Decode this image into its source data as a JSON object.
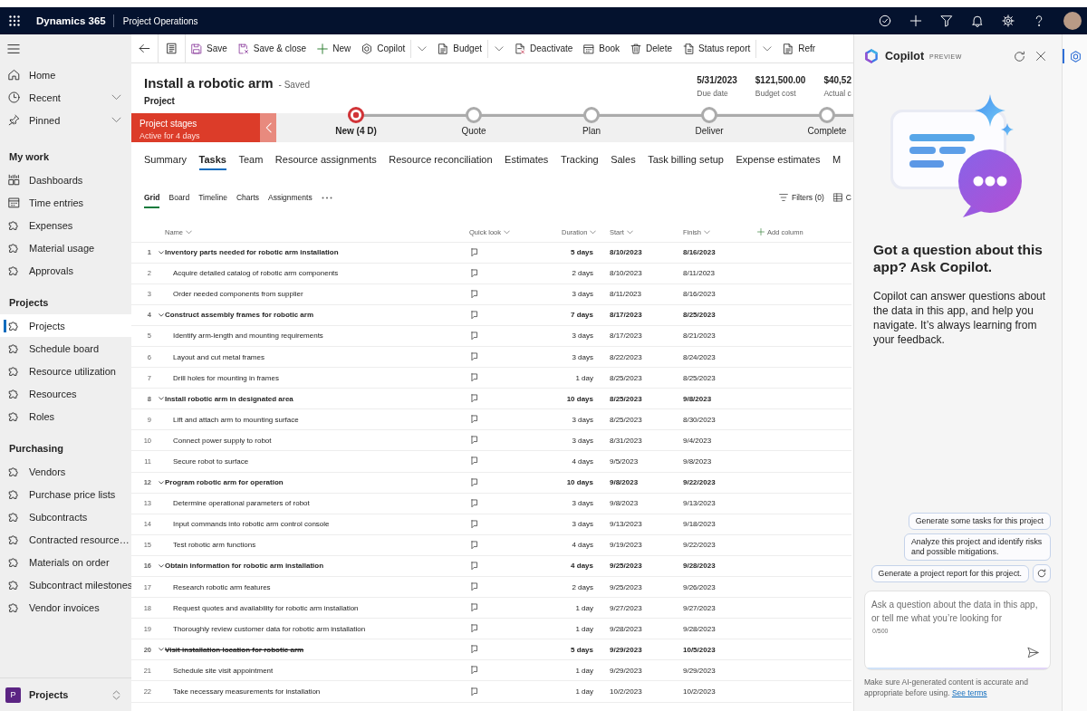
{
  "top_bar": {
    "app_name": "Dynamics 365",
    "area_name": "Project Operations"
  },
  "sidebar": {
    "top_items": [
      {
        "label": "Home",
        "selected": false
      },
      {
        "label": "Recent",
        "selected": false,
        "expanded": false
      },
      {
        "label": "Pinned",
        "selected": false,
        "expanded": false
      }
    ],
    "sections": [
      {
        "title": "My work",
        "items": [
          {
            "label": "Dashboards",
            "selected": false
          },
          {
            "label": "Time entries",
            "selected": false
          },
          {
            "label": "Expenses",
            "selected": false
          },
          {
            "label": "Material usage",
            "selected": false
          },
          {
            "label": "Approvals",
            "selected": false
          }
        ]
      },
      {
        "title": "Projects",
        "items": [
          {
            "label": "Projects",
            "selected": true
          },
          {
            "label": "Schedule board",
            "selected": false
          },
          {
            "label": "Resource utilization",
            "selected": false
          },
          {
            "label": "Resources",
            "selected": false
          },
          {
            "label": "Roles",
            "selected": false
          }
        ]
      },
      {
        "title": "Purchasing",
        "items": [
          {
            "label": "Vendors",
            "selected": false
          },
          {
            "label": "Purchase price lists",
            "selected": false
          },
          {
            "label": "Subcontracts",
            "selected": false
          },
          {
            "label": "Contracted resource…",
            "selected": false
          },
          {
            "label": "Materials on order",
            "selected": false
          },
          {
            "label": "Subcontract milestones",
            "selected": false
          },
          {
            "label": "Vendor invoices",
            "selected": false
          }
        ]
      }
    ],
    "area_switcher": {
      "badge": "P",
      "label": "Projects"
    }
  },
  "toolbar": {
    "items": [
      {
        "kind": "icon"
      },
      {
        "kind": "icon"
      },
      {
        "kind": "button",
        "label": "Save"
      },
      {
        "kind": "button",
        "label": "Save & close"
      },
      {
        "kind": "button",
        "label": "New"
      },
      {
        "kind": "button",
        "label": "Copilot"
      },
      {
        "kind": "chevron"
      },
      {
        "kind": "button",
        "label": "Budget"
      },
      {
        "kind": "chevron"
      },
      {
        "kind": "button",
        "label": "Deactivate"
      },
      {
        "kind": "button",
        "label": "Book"
      },
      {
        "kind": "button",
        "label": "Delete"
      },
      {
        "kind": "button",
        "label": "Status report"
      },
      {
        "kind": "chevron"
      },
      {
        "kind": "button",
        "label": "Refr"
      }
    ]
  },
  "record": {
    "title": "Install a robotic arm",
    "status": "- Saved",
    "entity": "Project",
    "fields": [
      {
        "value": "5/31/2023",
        "label": "Due date"
      },
      {
        "value": "$121,500.00",
        "label": "Budget cost"
      },
      {
        "value": "$40,52",
        "label": "Actual c"
      }
    ]
  },
  "stages": {
    "title": "Project stages",
    "status": "Active for 4 days",
    "steps": [
      {
        "label": "New (4 D)",
        "selected": true
      },
      {
        "label": "Quote",
        "selected": false
      },
      {
        "label": "Plan",
        "selected": false
      },
      {
        "label": "Deliver",
        "selected": false
      },
      {
        "label": "Complete",
        "selected": false
      }
    ]
  },
  "tabs": [
    {
      "label": "Summary",
      "selected": false
    },
    {
      "label": "Tasks",
      "selected": true
    },
    {
      "label": "Team",
      "selected": false
    },
    {
      "label": "Resource assignments",
      "selected": false
    },
    {
      "label": "Resource reconciliation",
      "selected": false
    },
    {
      "label": "Estimates",
      "selected": false
    },
    {
      "label": "Tracking",
      "selected": false
    },
    {
      "label": "Sales",
      "selected": false
    },
    {
      "label": "Task billing setup",
      "selected": false
    },
    {
      "label": "Expense estimates",
      "selected": false
    },
    {
      "label": "M",
      "selected": false
    }
  ],
  "view_tabs": {
    "items": [
      {
        "label": "Grid",
        "selected": true
      },
      {
        "label": "Board",
        "selected": false
      },
      {
        "label": "Timeline",
        "selected": false
      },
      {
        "label": "Charts",
        "selected": false
      },
      {
        "label": "Assignments",
        "selected": false
      }
    ],
    "actions": [
      {
        "label": "Filters (0)"
      },
      {
        "label": "C"
      }
    ]
  },
  "grid": {
    "columns": [
      "Name",
      "Quick look",
      "Duration",
      "Start",
      "Finish"
    ],
    "add_column": "Add column",
    "rows": [
      {
        "number": "1",
        "name": "Inventory parts needed for robotic arm installation",
        "duration": "5 days",
        "start": "8/10/2023",
        "finish": "8/16/2023",
        "struck": false,
        "expanded": true,
        "children": [
          {
            "number": "2",
            "name": "Acquire detailed catalog of robotic arm components",
            "duration": "2 days",
            "start": "8/10/2023",
            "finish": "8/11/2023",
            "struck": false
          },
          {
            "number": "3",
            "name": "Order needed components from supplier",
            "duration": "3 days",
            "start": "8/11/2023",
            "finish": "8/16/2023",
            "struck": false
          }
        ]
      },
      {
        "number": "4",
        "name": "Construct assembly frames for robotic arm",
        "duration": "7 days",
        "start": "8/17/2023",
        "finish": "8/25/2023",
        "struck": false,
        "expanded": true,
        "children": [
          {
            "number": "5",
            "name": "Identify arm-length and mounting requirements",
            "duration": "3 days",
            "start": "8/17/2023",
            "finish": "8/21/2023",
            "struck": false
          },
          {
            "number": "6",
            "name": "Layout and cut metal frames",
            "duration": "3 days",
            "start": "8/22/2023",
            "finish": "8/24/2023",
            "struck": false
          },
          {
            "number": "7",
            "name": "Drill holes for mounting in frames",
            "duration": "1 day",
            "start": "8/25/2023",
            "finish": "8/25/2023",
            "struck": false
          }
        ]
      },
      {
        "number": "8",
        "name": "Install robotic arm in designated area",
        "duration": "10 days",
        "start": "8/25/2023",
        "finish": "9/8/2023",
        "struck": false,
        "expanded": true,
        "children": [
          {
            "number": "9",
            "name": "Lift and attach arm to mounting surface",
            "duration": "3 days",
            "start": "8/25/2023",
            "finish": "8/30/2023",
            "struck": false
          },
          {
            "number": "10",
            "name": "Connect power supply to robot",
            "duration": "3 days",
            "start": "8/31/2023",
            "finish": "9/4/2023",
            "struck": false
          },
          {
            "number": "11",
            "name": "Secure robot to surface",
            "duration": "4 days",
            "start": "9/5/2023",
            "finish": "9/8/2023",
            "struck": false
          }
        ]
      },
      {
        "number": "12",
        "name": "Program robotic arm for operation",
        "duration": "10 days",
        "start": "9/8/2023",
        "finish": "9/22/2023",
        "struck": false,
        "expanded": true,
        "children": [
          {
            "number": "13",
            "name": "Determine operational parameters of robot",
            "duration": "3 days",
            "start": "9/8/2023",
            "finish": "9/13/2023",
            "struck": false
          },
          {
            "number": "14",
            "name": "Input commands into robotic arm control console",
            "duration": "3 days",
            "start": "9/13/2023",
            "finish": "9/18/2023",
            "struck": false
          },
          {
            "number": "15",
            "name": "Test robotic arm functions",
            "duration": "4 days",
            "start": "9/19/2023",
            "finish": "9/22/2023",
            "struck": false
          }
        ]
      },
      {
        "number": "16",
        "name": "Obtain information for robotic arm installation",
        "duration": "4 days",
        "start": "9/25/2023",
        "finish": "9/28/2023",
        "struck": false,
        "expanded": true,
        "children": [
          {
            "number": "17",
            "name": "Research robotic arm features",
            "duration": "2 days",
            "start": "9/25/2023",
            "finish": "9/26/2023",
            "struck": false
          },
          {
            "number": "18",
            "name": "Request quotes and availability for robotic arm installation",
            "duration": "1 day",
            "start": "9/27/2023",
            "finish": "9/27/2023",
            "struck": false
          },
          {
            "number": "19",
            "name": "Thoroughly review customer data for robotic arm installation",
            "duration": "1 day",
            "start": "9/28/2023",
            "finish": "9/28/2023",
            "struck": false
          }
        ]
      },
      {
        "number": "20",
        "name": "Visit installation location for robotic arm",
        "duration": "5 days",
        "start": "9/29/2023",
        "finish": "10/5/2023",
        "struck": true,
        "expanded": true,
        "children": [
          {
            "number": "21",
            "name": "Schedule site visit appointment",
            "duration": "1 day",
            "start": "9/29/2023",
            "finish": "9/29/2023",
            "struck": false
          },
          {
            "number": "22",
            "name": "Take necessary measurements for installation",
            "duration": "1 day",
            "start": "10/2/2023",
            "finish": "10/2/2023",
            "struck": false
          }
        ]
      }
    ]
  },
  "copilot": {
    "title": "Copilot",
    "badge": "PREVIEW",
    "heading": "Got a question about this app? Ask Copilot.",
    "description": "Copilot can answer questions about the data in this app, and help you navigate. It’s always learning from your feedback.",
    "suggestions": [
      "Generate some tasks for this project",
      "Analyze this project and identify risks and possible mitigations.",
      "Generate a project report for this project."
    ],
    "input": {
      "placeholder": "Ask a question about the data in this app, or tell me what you’re looking for",
      "counter": "0/500"
    },
    "disclaimer": {
      "text": "Make sure AI-generated content is accurate and appropriate before using.",
      "link": "See terms"
    }
  },
  "side_rail": {
    "items": [
      {
        "selected": true
      }
    ]
  }
}
